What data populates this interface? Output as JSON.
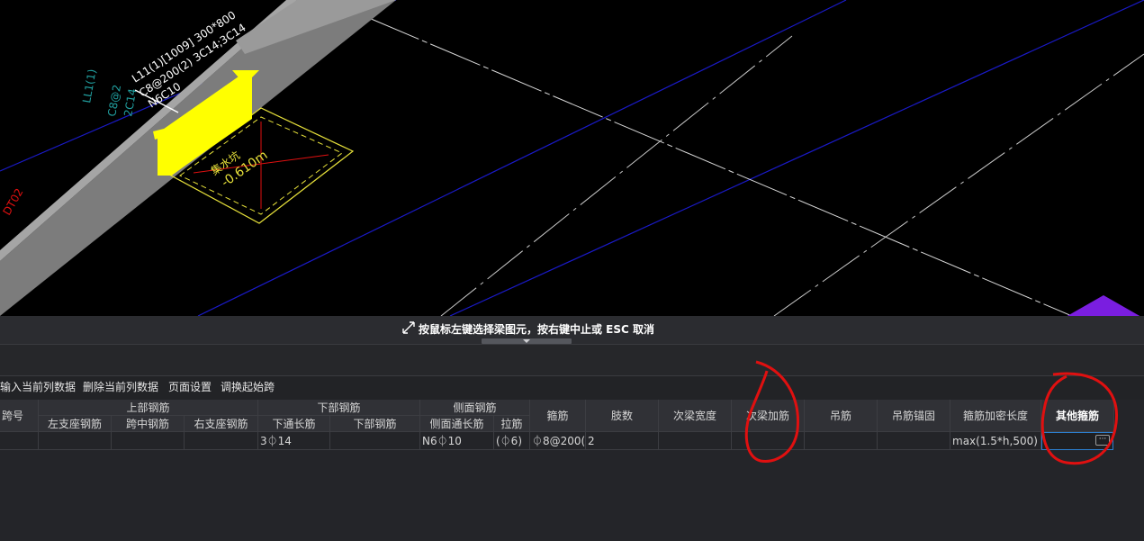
{
  "viewport": {
    "beam_label_line1": "L11(1)[1009] 300*800",
    "beam_label_line2": "C8@200(2) 3C14;3C14",
    "beam_label_line3": "N6C10",
    "beam_label_left1": "LL1(1)",
    "beam_label_left2": "C8@2",
    "beam_label_left3": "2C14",
    "axis_label": "DT02",
    "pit_label_1": "集水坑",
    "pit_label_2": "-0.610m"
  },
  "status": {
    "message": "按鼠标左键选择梁图元，按右键中止或 ESC 取消"
  },
  "toolbar": {
    "insert_col": "输入当前列数据",
    "delete_col": "删除当前列数据",
    "page_setup": "页面设置",
    "swap_span": "调换起始跨"
  },
  "table": {
    "headers": {
      "span_no": "跨号",
      "top_rebar": "上部钢筋",
      "left_support": "左支座钢筋",
      "mid_span": "跨中钢筋",
      "right_support": "右支座钢筋",
      "bottom_rebar": "下部钢筋",
      "bottom_through": "下通长筋",
      "bottom_rebar_sub": "下部钢筋",
      "side_rebar": "侧面钢筋",
      "side_through": "侧面通长筋",
      "tie_bar": "拉筋",
      "stirrup": "箍筋",
      "legs": "肢数",
      "sec_beam_width": "次梁宽度",
      "sec_beam_add": "次梁加筋",
      "hanger": "吊筋",
      "hanger_anchor": "吊筋锚固",
      "stirrup_dense_len": "箍筋加密长度",
      "other_stirrup": "其他箍筋"
    },
    "row": {
      "bottom_through": "3⏀14",
      "side_through": "N6⏀10",
      "tie_bar": "(⏀6)",
      "stirrup": "⏀8@200(",
      "legs": "2",
      "stirrup_dense_len": "max(1.5*h,500)"
    },
    "ellipsis": "···"
  },
  "colors": {
    "viewport_bg": "#000000",
    "beam_highlight": "#ffff00",
    "annotation_red": "#e01010",
    "accent_blue": "#2b7fd1"
  }
}
